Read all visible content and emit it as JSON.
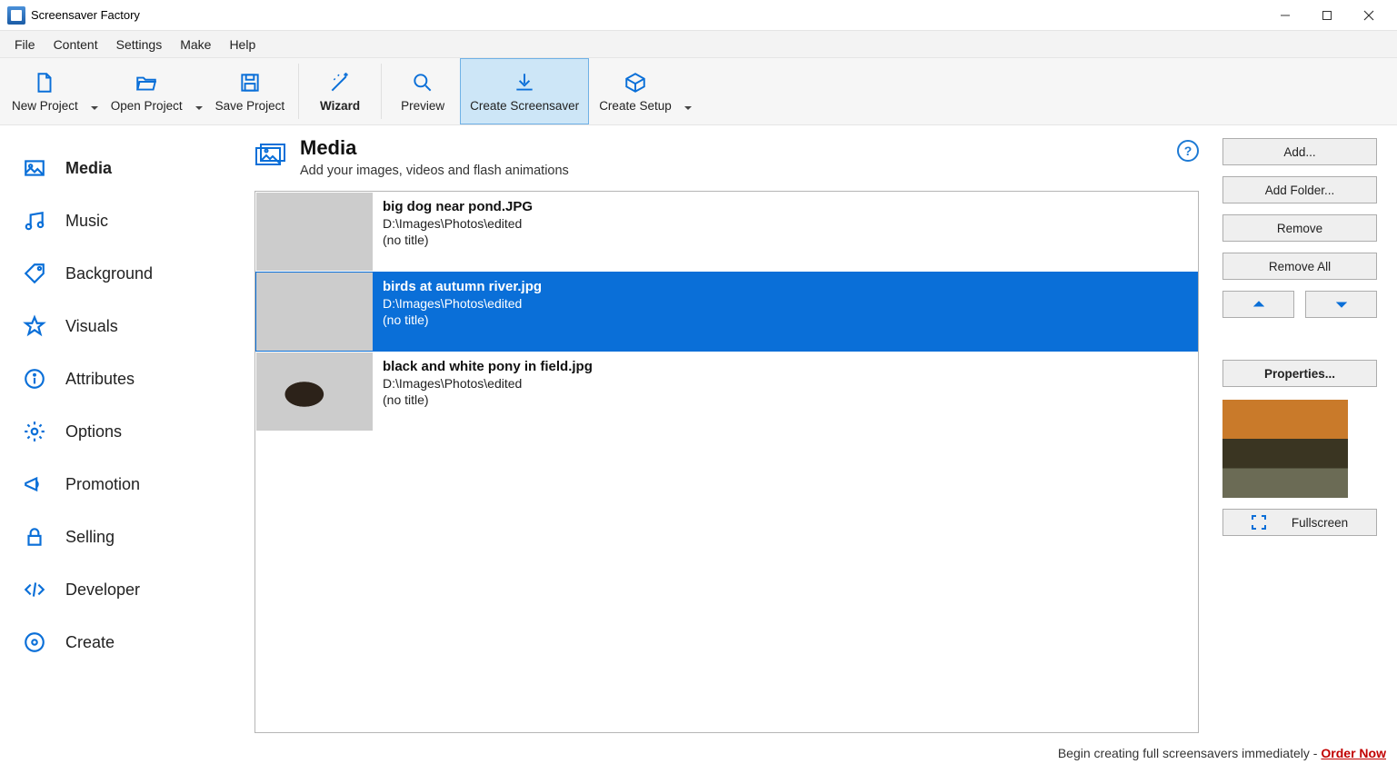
{
  "app": {
    "title": "Screensaver Factory"
  },
  "menubar": {
    "items": [
      "File",
      "Content",
      "Settings",
      "Make",
      "Help"
    ]
  },
  "toolbar": {
    "new_project": "New Project",
    "open_project": "Open Project",
    "save_project": "Save Project",
    "wizard": "Wizard",
    "preview": "Preview",
    "create_screensaver": "Create Screensaver",
    "create_setup": "Create Setup"
  },
  "sidebar": {
    "items": [
      {
        "label": "Media",
        "active": true
      },
      {
        "label": "Music"
      },
      {
        "label": "Background"
      },
      {
        "label": "Visuals"
      },
      {
        "label": "Attributes"
      },
      {
        "label": "Options"
      },
      {
        "label": "Promotion"
      },
      {
        "label": "Selling"
      },
      {
        "label": "Developer"
      },
      {
        "label": "Create"
      }
    ]
  },
  "page": {
    "title": "Media",
    "subtitle": "Add your images, videos and flash animations"
  },
  "media": {
    "items": [
      {
        "filename": "big dog near pond.JPG",
        "path": "D:\\Images\\Photos\\edited",
        "title": "(no title)",
        "selected": false
      },
      {
        "filename": "birds at autumn river.jpg",
        "path": "D:\\Images\\Photos\\edited",
        "title": "(no title)",
        "selected": true
      },
      {
        "filename": "black and white pony in field.jpg",
        "path": "D:\\Images\\Photos\\edited",
        "title": "(no title)",
        "selected": false
      }
    ]
  },
  "actions": {
    "add": "Add...",
    "add_folder": "Add Folder...",
    "remove": "Remove",
    "remove_all": "Remove All",
    "properties": "Properties...",
    "fullscreen": "Fullscreen"
  },
  "status": {
    "text": "Begin creating full screensavers immediately - ",
    "link": "Order Now"
  }
}
